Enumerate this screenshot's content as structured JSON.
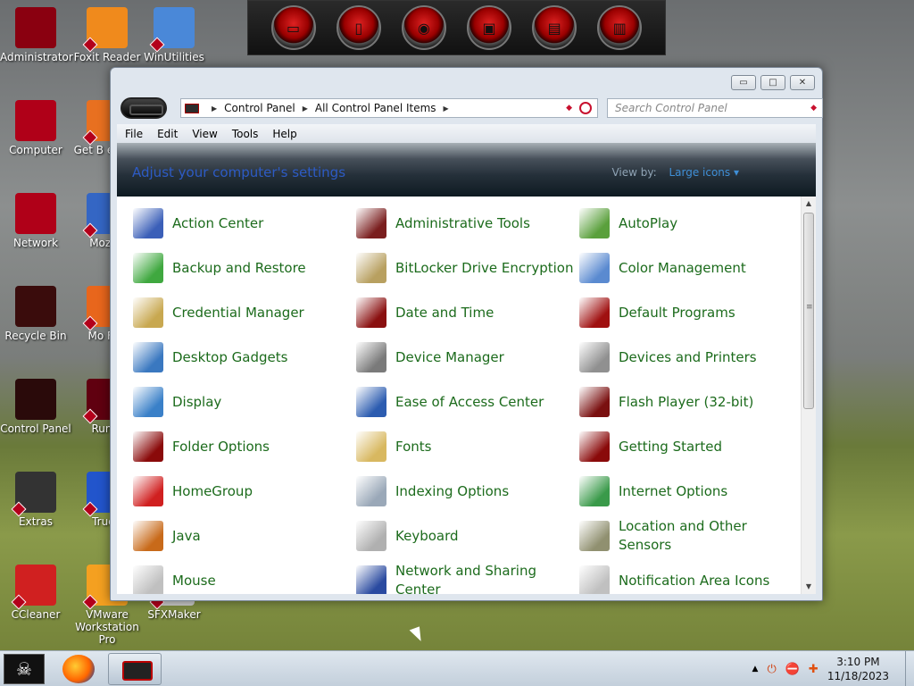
{
  "desktop": {
    "icons": [
      {
        "label": "Administrator",
        "color": "#8a0010"
      },
      {
        "label": "Foxit Reader",
        "color": "#f08a1c"
      },
      {
        "label": "WinUtilities",
        "color": "#4a88d8"
      },
      {
        "label": "Computer",
        "color": "#b00018"
      },
      {
        "label": "Get B extras",
        "color": "#e87020"
      },
      {
        "label": "Network",
        "color": "#b00018"
      },
      {
        "label": "MozBa",
        "color": "#3466c4"
      },
      {
        "label": "Recycle Bin",
        "color": "#3a0c0c"
      },
      {
        "label": "Mo Fire",
        "color": "#e8661c"
      },
      {
        "label": "Control Panel",
        "color": "#2a0a0a"
      },
      {
        "label": "Run V",
        "color": "#600010"
      },
      {
        "label": "Extras",
        "color": "#333333"
      },
      {
        "label": "TrueC",
        "color": "#2255cc"
      },
      {
        "label": "CCleaner",
        "color": "#d02020"
      },
      {
        "label": "VMware Workstation Pro",
        "color": "#f4a020"
      },
      {
        "label": "SFXMaker",
        "color": "#cccccc"
      }
    ]
  },
  "window": {
    "controls": {
      "minimize": "▭",
      "maximize": "□",
      "close": "✕"
    },
    "address": {
      "crumb1": "Control Panel",
      "crumb2": "All Control Panel Items"
    },
    "search": {
      "placeholder": "Search Control Panel"
    },
    "menu": [
      "File",
      "Edit",
      "View",
      "Tools",
      "Help"
    ],
    "banner": {
      "title": "Adjust your computer's settings",
      "view_by_label": "View by:",
      "view_by_value": "Large icons ▾"
    },
    "items": [
      {
        "label": "Action Center",
        "icon": "flag-icon",
        "color": "#3b5fb8"
      },
      {
        "label": "Administrative Tools",
        "icon": "tools-icon",
        "color": "#7a1e1e"
      },
      {
        "label": "AutoPlay",
        "icon": "autoplay-icon",
        "color": "#5aa03c"
      },
      {
        "label": "Backup and Restore",
        "icon": "backup-icon",
        "color": "#3fa83f"
      },
      {
        "label": "BitLocker Drive Encryption",
        "icon": "key-icon",
        "color": "#b8a060"
      },
      {
        "label": "Color Management",
        "icon": "color-icon",
        "color": "#5a8ad0"
      },
      {
        "label": "Credential Manager",
        "icon": "vault-icon",
        "color": "#c8a850"
      },
      {
        "label": "Date and Time",
        "icon": "clock-icon",
        "color": "#8a1010"
      },
      {
        "label": "Default Programs",
        "icon": "default-programs-icon",
        "color": "#a01010"
      },
      {
        "label": "Desktop Gadgets",
        "icon": "gadgets-icon",
        "color": "#3a78c0"
      },
      {
        "label": "Device Manager",
        "icon": "device-manager-icon",
        "color": "#7a7a7a"
      },
      {
        "label": "Devices and Printers",
        "icon": "printer-icon",
        "color": "#909090"
      },
      {
        "label": "Display",
        "icon": "display-icon",
        "color": "#3a80c8"
      },
      {
        "label": "Ease of Access Center",
        "icon": "accessibility-icon",
        "color": "#2c5cb0"
      },
      {
        "label": "Flash Player (32-bit)",
        "icon": "flash-icon",
        "color": "#7a1010"
      },
      {
        "label": "Folder Options",
        "icon": "folder-options-icon",
        "color": "#8a0a0a"
      },
      {
        "label": "Fonts",
        "icon": "fonts-icon",
        "color": "#d8b860"
      },
      {
        "label": "Getting Started",
        "icon": "getting-started-icon",
        "color": "#8a0a0a"
      },
      {
        "label": "HomeGroup",
        "icon": "homegroup-icon",
        "color": "#d02020"
      },
      {
        "label": "Indexing Options",
        "icon": "indexing-icon",
        "color": "#9aa8b8"
      },
      {
        "label": "Internet Options",
        "icon": "globe-icon",
        "color": "#3a9a4a"
      },
      {
        "label": "Java",
        "icon": "java-icon",
        "color": "#c86a1a"
      },
      {
        "label": "Keyboard",
        "icon": "keyboard-icon",
        "color": "#b0b0b0"
      },
      {
        "label": "Location and Other Sensors",
        "icon": "sensors-icon",
        "color": "#909070"
      },
      {
        "label": "Mouse",
        "icon": "mouse-icon",
        "color": "#c0c0c0"
      },
      {
        "label": "Network and Sharing Center",
        "icon": "network-icon",
        "color": "#2a4aa0"
      },
      {
        "label": "Notification Area Icons",
        "icon": "notification-icon",
        "color": "#c0c0c0"
      }
    ]
  },
  "taskbar": {
    "start_glyph": "☠",
    "clock": {
      "time": "3:10 PM",
      "date": "11/18/2023"
    },
    "tray": {
      "arrow": "▲",
      "power": "⏻",
      "blocked": "⛔",
      "network": "✚"
    }
  }
}
